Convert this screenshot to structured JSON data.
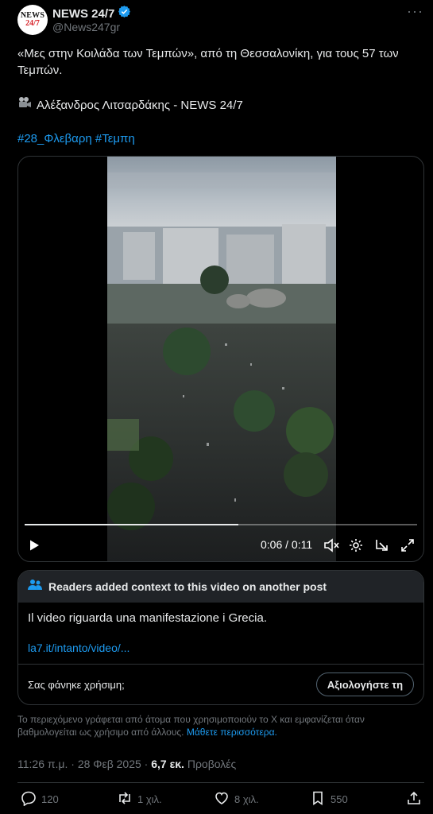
{
  "header": {
    "avatar_line1": "NEWS",
    "avatar_line2": "24/7",
    "name": "NEWS 24/7",
    "handle": "@News247gr",
    "more_label": "···"
  },
  "post": {
    "text": "«Μες στην Κοιλάδα των Τεμπών», από τη Θεσσαλονίκη, για τους 57 των Τεμπών.",
    "credit": "Αλέξανδρος Λιτσαρδάκης - NEWS 24/7",
    "hashtags": [
      "#28_Φλεβαρη",
      "#Τεμπη"
    ]
  },
  "video": {
    "time": "0:06 / 0:11",
    "progress": 0.545
  },
  "community_note": {
    "title": "Readers added context to this video on another post",
    "body": "Il video riguarda una manifestazione i Grecia.",
    "link": "la7.it/intanto/video/...",
    "question": "Σας φάνηκε χρήσιμη;",
    "rate_button": "Αξιολογήστε τη",
    "disclaimer": "Το περιεχόμενο γράφεται από άτομα που χρησιμοποιούν το X και εμφανίζεται όταν βαθμολογείται ως χρήσιμο από άλλους.",
    "learn_more": "Μάθετε περισσότερα."
  },
  "meta": {
    "timestamp": "11:26 π.μ. · 28 Φεβ 2025 · ",
    "views_count": "6,7 εκ.",
    "views_label": "Προβολές"
  },
  "actions": {
    "replies": "120",
    "reposts": "1 χιλ.",
    "likes": "8 χιλ.",
    "bookmarks": "550"
  },
  "colors": {
    "accent": "#1d9bf0",
    "muted": "#71767b",
    "border": "#2f3336"
  }
}
